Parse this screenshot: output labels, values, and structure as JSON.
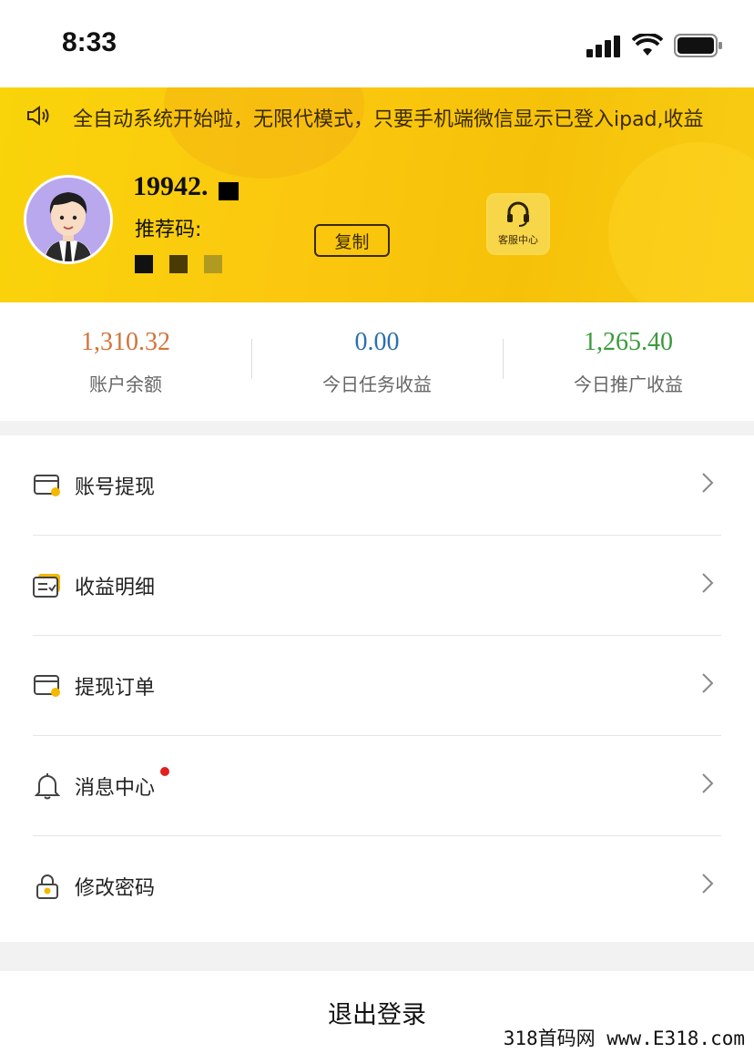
{
  "status_bar": {
    "time": "8:33"
  },
  "header": {
    "marquee_text": "全自动系统开始啦，无限代模式，只要手机端微信显示已登入ipad,收益",
    "user_id": "19942.",
    "ref_label": "推荐码:",
    "copy_label": "复制",
    "service_label": "客服中心"
  },
  "stats": [
    {
      "value": "1,310.32",
      "label": "账户余额",
      "color": "#d2733b"
    },
    {
      "value": "0.00",
      "label": "今日任务收益",
      "color": "#2a6fb0"
    },
    {
      "value": "1,265.40",
      "label": "今日推广收益",
      "color": "#3a9a3a"
    }
  ],
  "menu": {
    "items": [
      {
        "label": "账号提现",
        "icon": "wallet-card-icon"
      },
      {
        "label": "收益明细",
        "icon": "list-detail-icon"
      },
      {
        "label": "提现订单",
        "icon": "order-card-icon"
      },
      {
        "label": "消息中心",
        "icon": "bell-icon",
        "badge": true
      },
      {
        "label": "修改密码",
        "icon": "lock-icon"
      }
    ]
  },
  "logout_label": "退出登录",
  "watermark": "318首码网 www.E318.com",
  "colors": {
    "banner": "#f9d40a",
    "accent": "#f5b800",
    "badge": "#e02020"
  }
}
